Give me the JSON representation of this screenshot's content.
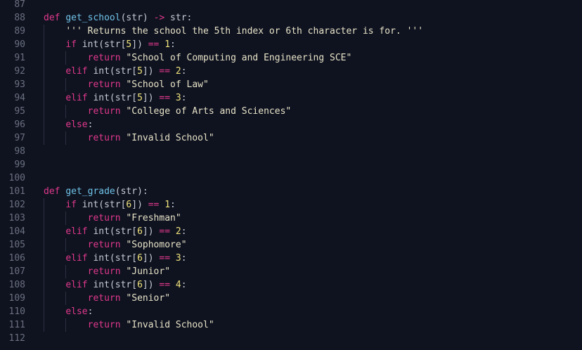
{
  "editor": {
    "lines": [
      {
        "n": "87",
        "g": 0,
        "t": []
      },
      {
        "n": "88",
        "g": 0,
        "t": [
          [
            "kw",
            "def"
          ],
          [
            "tx",
            " "
          ],
          [
            "fn",
            "get_school"
          ],
          [
            "tx",
            "(str) "
          ],
          [
            "op",
            "->"
          ],
          [
            "tx",
            " str:"
          ]
        ]
      },
      {
        "n": "89",
        "g": 1,
        "t": [
          [
            "tx",
            "    "
          ],
          [
            "cm",
            "''' Returns the school the 5th index or 6th character is for. '''"
          ]
        ]
      },
      {
        "n": "90",
        "g": 1,
        "t": [
          [
            "tx",
            "    "
          ],
          [
            "kw",
            "if"
          ],
          [
            "tx",
            " int(str["
          ],
          [
            "num",
            "5"
          ],
          [
            "tx",
            "]) "
          ],
          [
            "op",
            "=="
          ],
          [
            "tx",
            " "
          ],
          [
            "num",
            "1"
          ],
          [
            "tx",
            ":"
          ]
        ]
      },
      {
        "n": "91",
        "g": 2,
        "t": [
          [
            "tx",
            "        "
          ],
          [
            "kw",
            "return"
          ],
          [
            "tx",
            " "
          ],
          [
            "str",
            "\"School of Computing and Engineering SCE\""
          ]
        ]
      },
      {
        "n": "92",
        "g": 1,
        "t": [
          [
            "tx",
            "    "
          ],
          [
            "kw",
            "elif"
          ],
          [
            "tx",
            " int(str["
          ],
          [
            "num",
            "5"
          ],
          [
            "tx",
            "]) "
          ],
          [
            "op",
            "=="
          ],
          [
            "tx",
            " "
          ],
          [
            "num",
            "2"
          ],
          [
            "tx",
            ":"
          ]
        ]
      },
      {
        "n": "93",
        "g": 2,
        "t": [
          [
            "tx",
            "        "
          ],
          [
            "kw",
            "return"
          ],
          [
            "tx",
            " "
          ],
          [
            "str",
            "\"School of Law\""
          ]
        ]
      },
      {
        "n": "94",
        "g": 1,
        "t": [
          [
            "tx",
            "    "
          ],
          [
            "kw",
            "elif"
          ],
          [
            "tx",
            " int(str["
          ],
          [
            "num",
            "5"
          ],
          [
            "tx",
            "]) "
          ],
          [
            "op",
            "=="
          ],
          [
            "tx",
            " "
          ],
          [
            "num",
            "3"
          ],
          [
            "tx",
            ":"
          ]
        ]
      },
      {
        "n": "95",
        "g": 2,
        "t": [
          [
            "tx",
            "        "
          ],
          [
            "kw",
            "return"
          ],
          [
            "tx",
            " "
          ],
          [
            "str",
            "\"College of Arts and Sciences\""
          ]
        ]
      },
      {
        "n": "96",
        "g": 1,
        "t": [
          [
            "tx",
            "    "
          ],
          [
            "kw",
            "else"
          ],
          [
            "tx",
            ":"
          ]
        ]
      },
      {
        "n": "97",
        "g": 2,
        "t": [
          [
            "tx",
            "        "
          ],
          [
            "kw",
            "return"
          ],
          [
            "tx",
            " "
          ],
          [
            "str",
            "\"Invalid School\""
          ]
        ]
      },
      {
        "n": "98",
        "g": 0,
        "t": []
      },
      {
        "n": "99",
        "g": 0,
        "t": []
      },
      {
        "n": "100",
        "g": 0,
        "t": []
      },
      {
        "n": "101",
        "g": 0,
        "t": [
          [
            "kw",
            "def"
          ],
          [
            "tx",
            " "
          ],
          [
            "fn",
            "get_grade"
          ],
          [
            "tx",
            "(str):"
          ]
        ]
      },
      {
        "n": "102",
        "g": 1,
        "t": [
          [
            "tx",
            "    "
          ],
          [
            "kw",
            "if"
          ],
          [
            "tx",
            " int(str["
          ],
          [
            "num",
            "6"
          ],
          [
            "tx",
            "]) "
          ],
          [
            "op",
            "=="
          ],
          [
            "tx",
            " "
          ],
          [
            "num",
            "1"
          ],
          [
            "tx",
            ":"
          ]
        ]
      },
      {
        "n": "103",
        "g": 2,
        "t": [
          [
            "tx",
            "        "
          ],
          [
            "kw",
            "return"
          ],
          [
            "tx",
            " "
          ],
          [
            "str",
            "\"Freshman\""
          ]
        ]
      },
      {
        "n": "104",
        "g": 1,
        "t": [
          [
            "tx",
            "    "
          ],
          [
            "kw",
            "elif"
          ],
          [
            "tx",
            " int(str["
          ],
          [
            "num",
            "6"
          ],
          [
            "tx",
            "]) "
          ],
          [
            "op",
            "=="
          ],
          [
            "tx",
            " "
          ],
          [
            "num",
            "2"
          ],
          [
            "tx",
            ":"
          ]
        ]
      },
      {
        "n": "105",
        "g": 2,
        "t": [
          [
            "tx",
            "        "
          ],
          [
            "kw",
            "return"
          ],
          [
            "tx",
            " "
          ],
          [
            "str",
            "\"Sophomore\""
          ]
        ]
      },
      {
        "n": "106",
        "g": 1,
        "t": [
          [
            "tx",
            "    "
          ],
          [
            "kw",
            "elif"
          ],
          [
            "tx",
            " int(str["
          ],
          [
            "num",
            "6"
          ],
          [
            "tx",
            "]) "
          ],
          [
            "op",
            "=="
          ],
          [
            "tx",
            " "
          ],
          [
            "num",
            "3"
          ],
          [
            "tx",
            ":"
          ]
        ]
      },
      {
        "n": "107",
        "g": 2,
        "t": [
          [
            "tx",
            "        "
          ],
          [
            "kw",
            "return"
          ],
          [
            "tx",
            " "
          ],
          [
            "str",
            "\"Junior\""
          ]
        ]
      },
      {
        "n": "108",
        "g": 1,
        "t": [
          [
            "tx",
            "    "
          ],
          [
            "kw",
            "elif"
          ],
          [
            "tx",
            " int(str["
          ],
          [
            "num",
            "6"
          ],
          [
            "tx",
            "]) "
          ],
          [
            "op",
            "=="
          ],
          [
            "tx",
            " "
          ],
          [
            "num",
            "4"
          ],
          [
            "tx",
            ":"
          ]
        ]
      },
      {
        "n": "109",
        "g": 2,
        "t": [
          [
            "tx",
            "        "
          ],
          [
            "kw",
            "return"
          ],
          [
            "tx",
            " "
          ],
          [
            "str",
            "\"Senior\""
          ]
        ]
      },
      {
        "n": "110",
        "g": 1,
        "t": [
          [
            "tx",
            "    "
          ],
          [
            "kw",
            "else"
          ],
          [
            "tx",
            ":"
          ]
        ]
      },
      {
        "n": "111",
        "g": 2,
        "t": [
          [
            "tx",
            "        "
          ],
          [
            "kw",
            "return"
          ],
          [
            "tx",
            " "
          ],
          [
            "str",
            "\"Invalid School\""
          ]
        ]
      },
      {
        "n": "112",
        "g": 0,
        "t": []
      }
    ]
  }
}
